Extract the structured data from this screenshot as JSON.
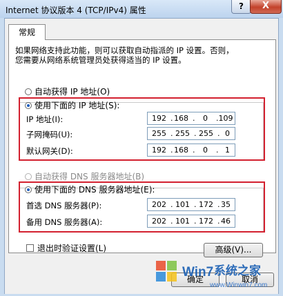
{
  "window": {
    "title": "Internet 协议版本 4 (TCP/IPv4) 属性",
    "help_label": "?",
    "close_label": "X"
  },
  "tabs": [
    {
      "label": "常规"
    }
  ],
  "description": [
    "如果网络支持此功能，则可以获取自动指派的 IP 设置。否则，",
    "您需要从网络系统管理员处获得适当的 IP 设置。"
  ],
  "ip_section": {
    "auto_label": "自动获得 IP 地址(O)",
    "manual_label": "使用下面的 IP 地址(S):",
    "selected": "manual",
    "fields": [
      {
        "label": "IP 地址(I):",
        "octets": [
          "192",
          "168",
          "0",
          ".109"
        ]
      },
      {
        "label": "子网掩码(U):",
        "octets": [
          "255",
          "255",
          "255",
          "0"
        ]
      },
      {
        "label": "默认网关(D):",
        "octets": [
          "192",
          "168",
          "0",
          "1"
        ]
      }
    ]
  },
  "dns_section": {
    "auto_label": "自动获得 DNS 服务器地址(B)",
    "manual_label": "使用下面的 DNS 服务器地址(E):",
    "selected": "manual",
    "fields": [
      {
        "label": "首选 DNS 服务器(P):",
        "octets": [
          "202",
          "101",
          "172",
          "35"
        ]
      },
      {
        "label": "备用 DNS 服务器(A):",
        "octets": [
          "202",
          "101",
          "172",
          "46"
        ]
      }
    ]
  },
  "validate_on_exit_label": "退出时验证设置(L)",
  "advanced_button": "高级(V)...",
  "ok_button": "确定",
  "cancel_button": "取消",
  "watermark": {
    "text": "系统之家",
    "url": "www.Winwin7.com",
    "brand": "Win7"
  },
  "colors": {
    "highlight_box": "#d3202f",
    "title_bar": "#c9dcf0"
  }
}
